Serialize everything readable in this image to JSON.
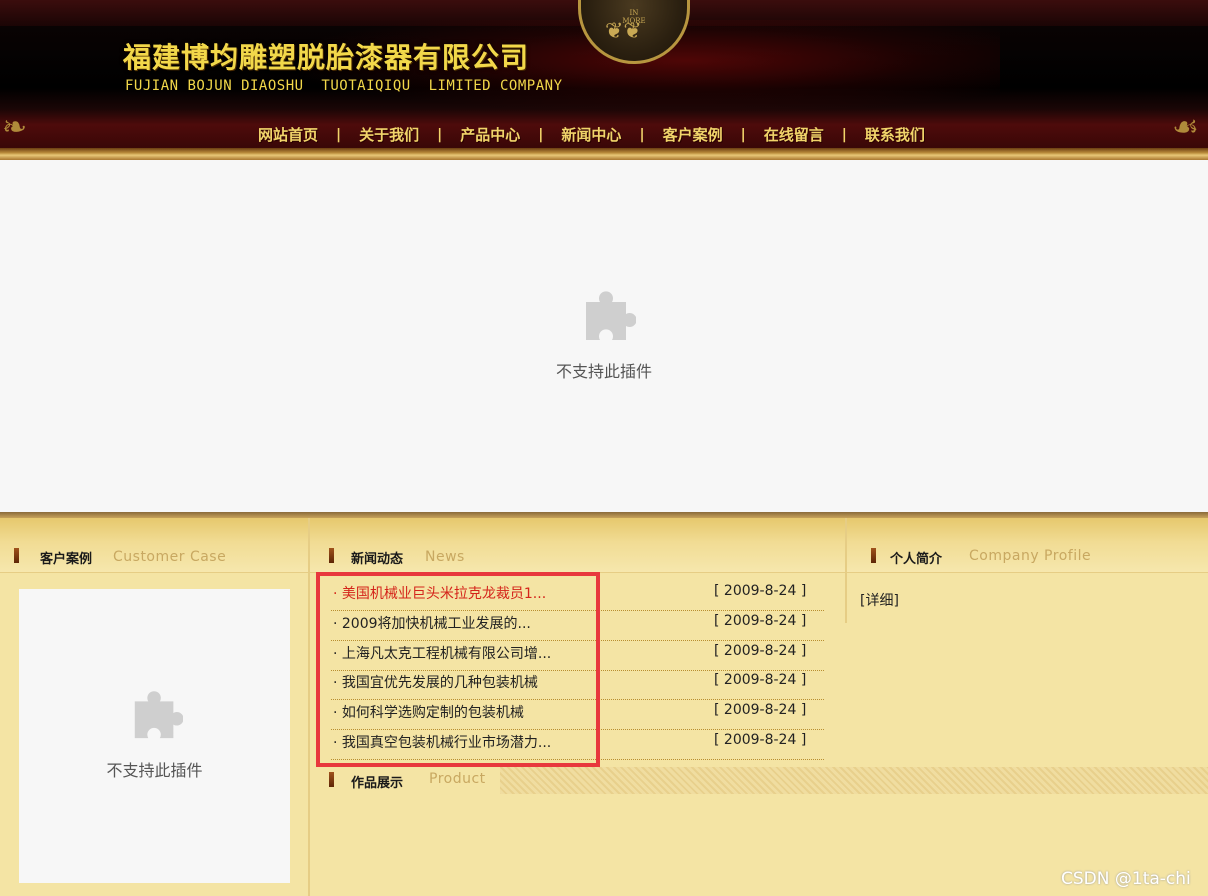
{
  "header": {
    "company_cn": "福建博均雕塑脱胎漆器有限公司",
    "company_en": "FUJIAN BOJUN DIAOSHU  TUOTAIQIQU  LIMITED COMPANY",
    "emblem_text": "IN\nMORE"
  },
  "nav": {
    "items": [
      "网站首页",
      "关于我们",
      "产品中心",
      "新闻中心",
      "客户案例",
      "在线留言",
      "联系我们"
    ],
    "separator": "|"
  },
  "plugin": {
    "message": "不支持此插件"
  },
  "sections": {
    "customer": {
      "title_cn": "客户案例",
      "title_en": "Customer Case"
    },
    "news": {
      "title_cn": "新闻动态",
      "title_en": "News"
    },
    "profile": {
      "title_cn": "个人简介",
      "title_en": "Company Profile",
      "detail_link": "[详细]"
    },
    "product": {
      "title_cn": "作品展示",
      "title_en": "Product"
    }
  },
  "news_items": [
    {
      "title": "· 美国机械业巨头米拉克龙裁员1...",
      "date": "[ 2009-8-24 ]",
      "active": true
    },
    {
      "title": "· 2009将加快机械工业发展的...",
      "date": "[ 2009-8-24 ]",
      "active": false
    },
    {
      "title": "· 上海凡太克工程机械有限公司增...",
      "date": "[ 2009-8-24 ]",
      "active": false
    },
    {
      "title": "· 我国宜优先发展的几种包装机械",
      "date": "[ 2009-8-24 ]",
      "active": false
    },
    {
      "title": "· 如何科学选购定制的包装机械",
      "date": "[ 2009-8-24 ]",
      "active": false
    },
    {
      "title": "· 我国真空包装机械行业市场潜力...",
      "date": "[ 2009-8-24 ]",
      "active": false
    }
  ],
  "watermark": "CSDN @1ta-chi",
  "colors": {
    "nav_gold": "#f1d46a",
    "panel_bg": "#f4e4a4",
    "highlight_red": "#e8383d",
    "active_news": "#d4241a"
  }
}
